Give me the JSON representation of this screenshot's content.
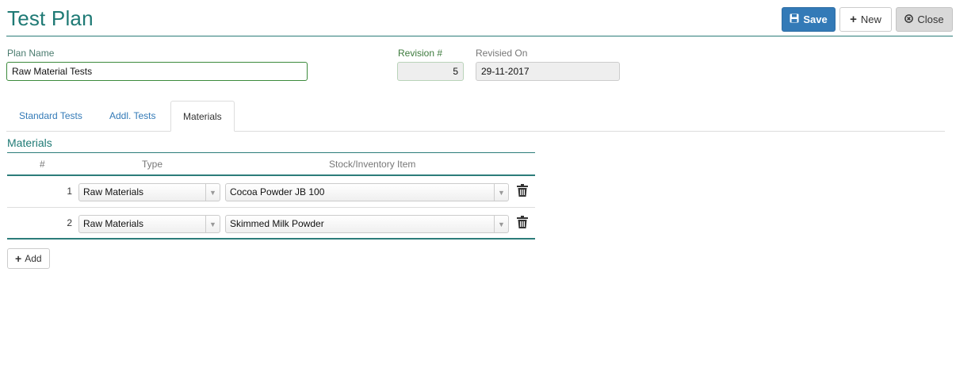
{
  "header": {
    "title": "Test Plan",
    "buttons": {
      "save": "Save",
      "new": "New",
      "close": "Close"
    }
  },
  "form": {
    "plan_name_label": "Plan Name",
    "plan_name_value": "Raw Material Tests",
    "revision_label": "Revision #",
    "revision_value": "5",
    "revised_on_label": "Revisied On",
    "revised_on_value": "29-11-2017"
  },
  "tabs": [
    {
      "label": "Standard Tests",
      "active": false
    },
    {
      "label": "Addl. Tests",
      "active": false
    },
    {
      "label": "Materials",
      "active": true
    }
  ],
  "materials": {
    "section_title": "Materials",
    "columns": [
      "#",
      "Type",
      "Stock/Inventory Item"
    ],
    "rows": [
      {
        "num": "1",
        "type": "Raw Materials",
        "item": "Cocoa Powder JB 100"
      },
      {
        "num": "2",
        "type": "Raw Materials",
        "item": "Skimmed Milk Powder"
      }
    ],
    "add_label": "Add"
  },
  "colors": {
    "accent": "#1f7a75",
    "primary": "#337ab7"
  },
  "icons": {
    "save": "floppy-disk-icon",
    "new": "plus-icon",
    "close": "circle-x-icon",
    "delete": "trash-icon",
    "add": "plus-icon"
  }
}
